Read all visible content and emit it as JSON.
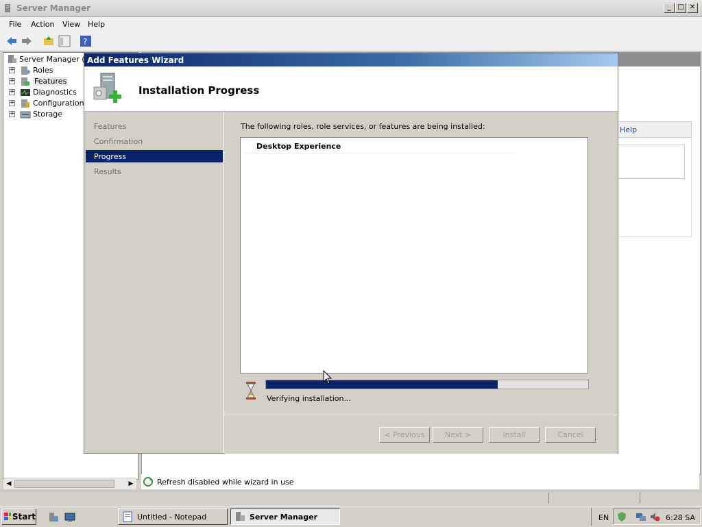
{
  "window": {
    "title": "Server Manager"
  },
  "menu": [
    "File",
    "Action",
    "View",
    "Help"
  ],
  "tree": {
    "root": "Server Manager (W",
    "items": [
      {
        "label": "Roles"
      },
      {
        "label": "Features"
      },
      {
        "label": "Diagnostics"
      },
      {
        "label": "Configuration"
      },
      {
        "label": "Storage"
      }
    ]
  },
  "background_pane": {
    "help_link": "Help"
  },
  "status": {
    "text": "Refresh disabled while wizard in use"
  },
  "dialog": {
    "title": "Add Features Wizard",
    "header": "Installation Progress",
    "nav": [
      "Features",
      "Confirmation",
      "Progress",
      "Results"
    ],
    "selected_nav": "Progress",
    "intro": "The following roles, role services, or features are being installed:",
    "items": [
      "Desktop Experience"
    ],
    "progress": {
      "fraction": 0.72,
      "text": "Verifying installation..."
    },
    "buttons": {
      "previous": "< Previous",
      "next": "Next >",
      "install": "Install",
      "cancel": "Cancel"
    }
  },
  "taskbar": {
    "start": "Start",
    "tasks": [
      "Untitled - Notepad",
      "Server Manager"
    ],
    "lang": "EN",
    "clock": "6:28 SA"
  },
  "colors": {
    "selection": "#0a246a",
    "title_gradient_end": "#a6caf0"
  }
}
